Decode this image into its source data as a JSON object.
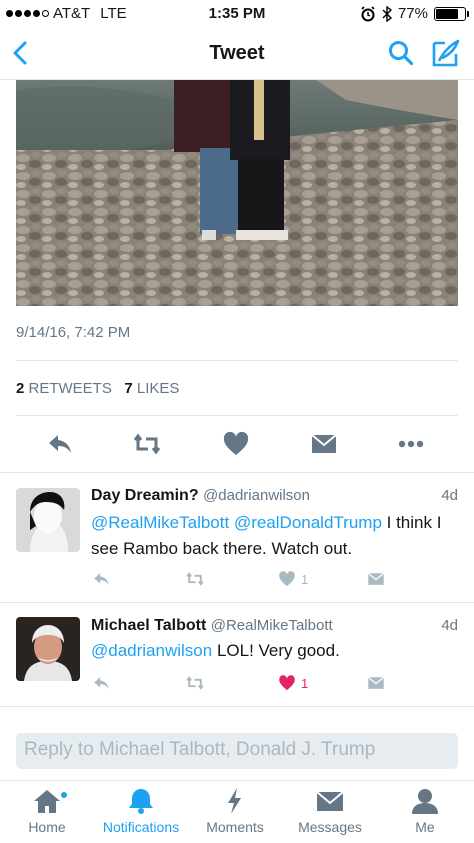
{
  "status_bar": {
    "carrier": "AT&T",
    "network": "LTE",
    "time": "1:35 PM",
    "battery_percent": "77%",
    "battery_level": 0.77
  },
  "nav": {
    "title": "Tweet",
    "back_icon": "chevron-left-icon",
    "search_icon": "search-icon",
    "compose_icon": "compose-icon"
  },
  "tweet": {
    "timestamp": "9/14/16, 7:42 PM",
    "retweets_count": "2",
    "retweets_label": "RETWEETS",
    "likes_count": "7",
    "likes_label": "LIKES"
  },
  "replies": [
    {
      "name": "Day Dreamin?",
      "handle": "@dadrianwilson",
      "time": "4d",
      "mentions": [
        "@RealMikeTalbott",
        "@realDonaldTrump"
      ],
      "text": "I think I see Rambo back there. Watch out.",
      "likes": "1",
      "liked": false
    },
    {
      "name": "Michael Talbott",
      "handle": "@RealMikeTalbott",
      "time": "4d",
      "mentions": [
        "@dadrianwilson"
      ],
      "text": "LOL! Very good.",
      "likes": "1",
      "liked": true
    }
  ],
  "reply_box": {
    "placeholder": "Reply to Michael Talbott, Donald J. Trump"
  },
  "tabs": [
    {
      "label": "Home",
      "icon": "home-icon",
      "active": false
    },
    {
      "label": "Notifications",
      "icon": "bell-icon",
      "active": true
    },
    {
      "label": "Moments",
      "icon": "lightning-icon",
      "active": false
    },
    {
      "label": "Messages",
      "icon": "envelope-icon",
      "active": false
    },
    {
      "label": "Me",
      "icon": "person-icon",
      "active": false
    }
  ],
  "colors": {
    "accent": "#1da1f2",
    "liked": "#e0245e",
    "muted": "#657786",
    "icon_gray": "#aab8c2"
  }
}
